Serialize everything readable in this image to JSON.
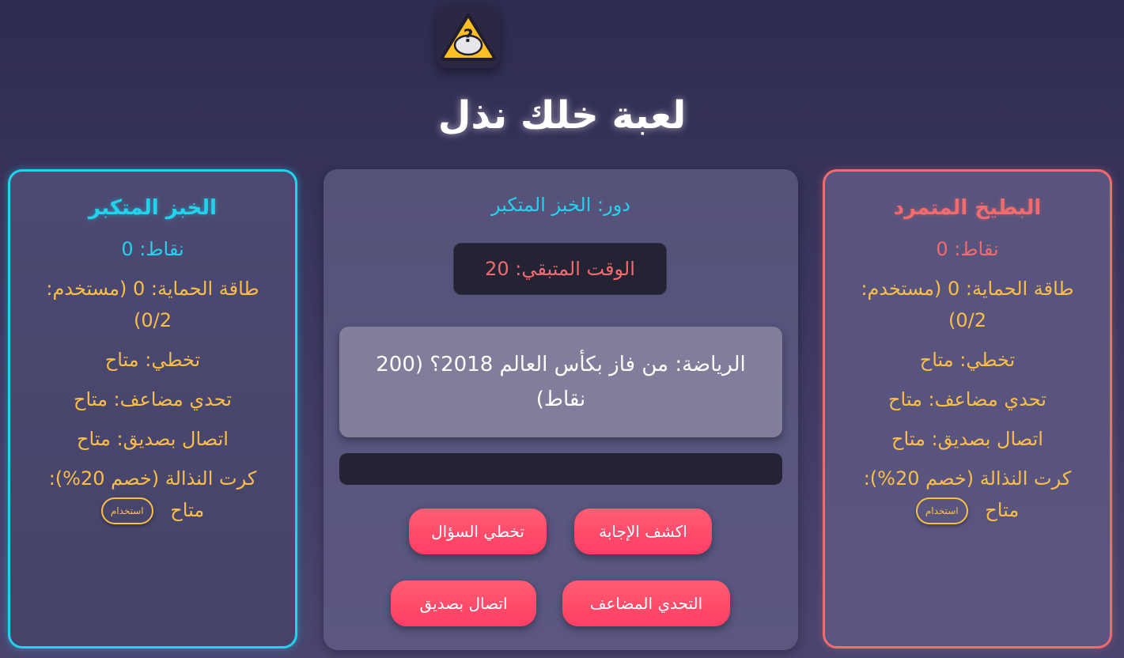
{
  "game": {
    "title": "لعبة خلك نذل",
    "logo_icon": "warning-question-icon"
  },
  "players": [
    {
      "name": "الخبز المتكبر",
      "color": "#22d3ee",
      "score": "نقاط: 0",
      "shield": "طاقة الحماية: 0 (مستخدم: 0/2)",
      "skip": "تخطي: متاح",
      "double": "تحدي مضاعف: متاح",
      "call": "اتصال بصديق: متاح",
      "card": "كرت النذالة (خصم 20%):",
      "card_status": "متاح",
      "use_label": "استخدام"
    },
    {
      "name": "البطيخ المتمرد",
      "color": "#f26b6f",
      "score": "نقاط: 0",
      "shield": "طاقة الحماية: 0 (مستخدم: 0/2)",
      "skip": "تخطي: متاح",
      "double": "تحدي مضاعف: متاح",
      "call": "اتصال بصديق: متاح",
      "card": "كرت النذالة (خصم 20%):",
      "card_status": "متاح",
      "use_label": "استخدام"
    }
  ],
  "center": {
    "turn": "دور: الخبز المتكبر",
    "timer": "الوقت المتبقي: 20",
    "question": "الرياضة: من فاز بكأس العالم 2018؟ (200 نقاط)",
    "answer": "",
    "buttons": {
      "reveal": "اكشف الإجابة",
      "skip": "تخطي السؤال",
      "double": "التحدي المضاعف",
      "call": "اتصال بصديق"
    }
  }
}
